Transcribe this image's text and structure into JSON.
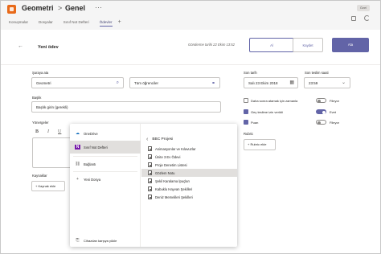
{
  "header": {
    "team_name": "Geometri",
    "separator": ">",
    "channel_name": "Genel",
    "more": "···",
    "private_label": "Özel"
  },
  "tabs": [
    {
      "label": "Konuşmalar",
      "active": false
    },
    {
      "label": "Dosyalar",
      "active": false
    },
    {
      "label": "Sınıf Not Defteri",
      "active": false
    },
    {
      "label": "Ödevler",
      "active": true
    }
  ],
  "tab_add": "+",
  "assignment": {
    "back": "←",
    "title": "Yeni ödev",
    "sent_date": "Gönderme tarihi 22 Ekim 13:52",
    "cancel_label": "Al",
    "save_label": "Kaydet",
    "assign_label": "Ata"
  },
  "form": {
    "assign_to_label": "Şuraya ata",
    "class_value": "Geometri",
    "students_value": "Tüm öğrenciler",
    "title_label": "Başlık",
    "title_placeholder": "Başlık girin (gerekli)",
    "instructions_label": "Yönergeler",
    "toolbar": [
      "B",
      "I",
      "U",
      "A"
    ],
    "resources_label": "Kaynaklar",
    "add_resource_label": "+ Kaynak ekle"
  },
  "due": {
    "due_date_label": "Son tarih",
    "due_date_value": "Salı 23 Ekim 2018",
    "due_time_label": "Son teslim saati",
    "due_time_value": "23:59",
    "options": [
      {
        "label": "Daha sonra atamak için zamanla",
        "checked": false,
        "toggle_label": "Fileyor",
        "toggle_on": false
      },
      {
        "label": "Geç teslime izin verildi",
        "checked": true,
        "toggle_label": "Evet",
        "toggle_on": true
      },
      {
        "label": "Puan",
        "checked": true,
        "toggle_label": "Fileyor",
        "toggle_on": false
      }
    ],
    "rubric_label": "Rubric",
    "add_rubric_label": "+ Rubric ekle"
  },
  "attach_panel": {
    "sources": [
      {
        "icon": "onedrive-icon",
        "glyph": "☁",
        "label": "OneDrive",
        "selected": false,
        "color": "#0364b8"
      },
      {
        "icon": "notebook-icon",
        "glyph": "N",
        "label": "Sınıf Not Defteri",
        "selected": true,
        "color": "#7719aa"
      },
      {
        "icon": "link-icon",
        "glyph": "🔗",
        "label": "Bağlantı",
        "selected": false,
        "color": "#605e5c"
      },
      {
        "icon": "new-file-icon",
        "glyph": "+",
        "label": "Yeni Dosya",
        "selected": false,
        "color": "#605e5c"
      }
    ],
    "upload_label": "Cihazdan karşıya yükle",
    "folder_title": "BBC Projesi",
    "files": [
      {
        "name": "Animasyonlar ve Kılavuzlar",
        "selected": false
      },
      {
        "name": "Ünite 3 Ev Ödevi",
        "selected": false
      },
      {
        "name": "Proje Denetim Listesi",
        "selected": false
      },
      {
        "name": "Gözlem Notu",
        "selected": true
      },
      {
        "name": "Şekil Karalama İpuçları",
        "selected": false
      },
      {
        "name": "Kabuklu Hayvan Şekilleri",
        "selected": false
      },
      {
        "name": "Deniz Memelileri Şekilleri",
        "selected": false
      }
    ]
  }
}
